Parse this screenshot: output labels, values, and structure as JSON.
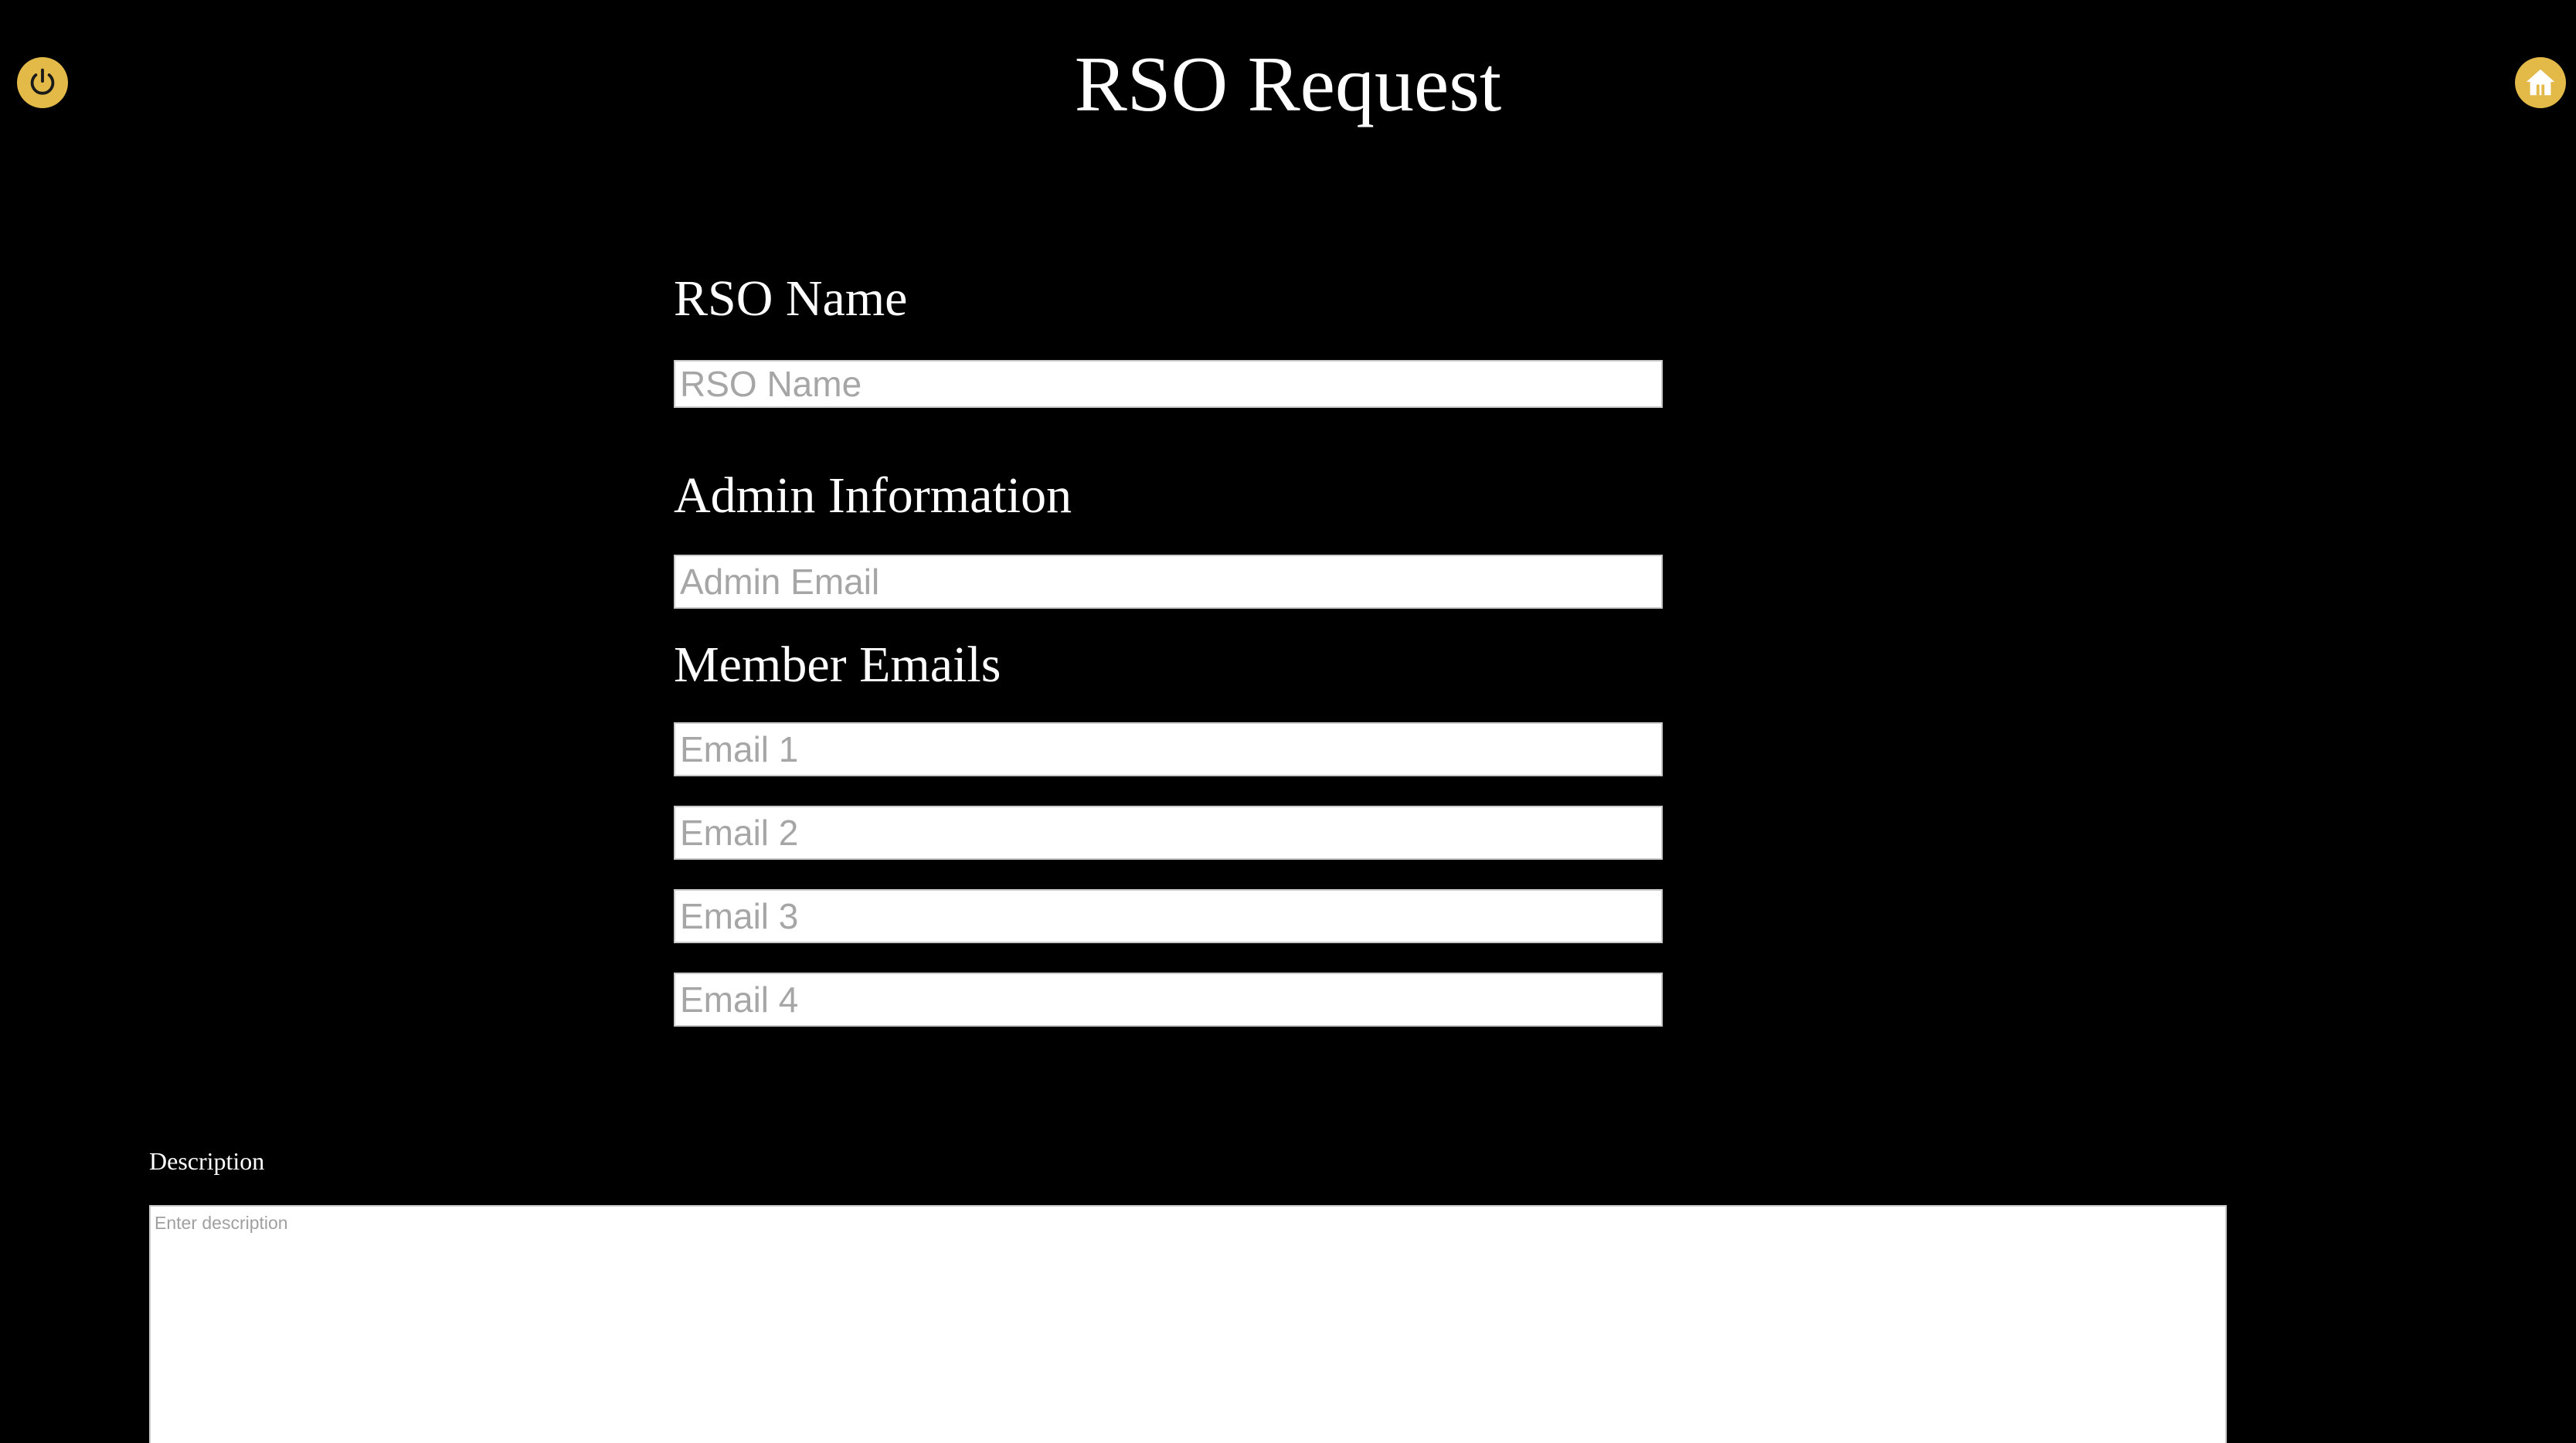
{
  "header": {
    "title": "RSO Request",
    "power_icon": "power-icon",
    "home_icon": "home-icon",
    "accent_color": "#e3b948"
  },
  "form": {
    "rso_name": {
      "label": "RSO Name",
      "value": "",
      "placeholder": "RSO Name"
    },
    "admin": {
      "label": "Admin Information",
      "email_value": "",
      "email_placeholder": "Admin Email"
    },
    "members": {
      "label": "Member Emails",
      "emails": [
        {
          "value": "",
          "placeholder": "Email 1"
        },
        {
          "value": "",
          "placeholder": "Email 2"
        },
        {
          "value": "",
          "placeholder": "Email 3"
        },
        {
          "value": "",
          "placeholder": "Email 4"
        }
      ]
    },
    "description": {
      "label": "Description",
      "value": "",
      "placeholder": "Enter description"
    }
  }
}
